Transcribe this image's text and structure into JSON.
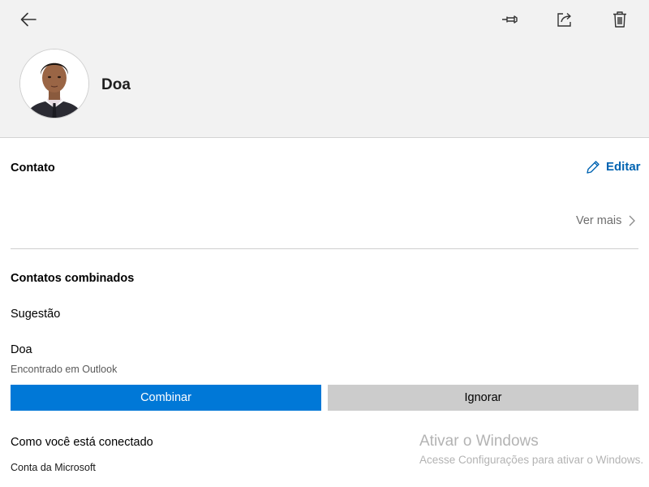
{
  "header": {
    "icons": {
      "back": "arrow-left-icon",
      "pin": "pin-icon",
      "share": "share-icon",
      "delete": "trash-icon"
    },
    "profile_name": "Doa"
  },
  "contact_section": {
    "title": "Contato",
    "edit_label": "Editar",
    "see_more_label": "Ver mais"
  },
  "merged_section": {
    "title": "Contatos combinados",
    "suggestion_label": "Sugestão",
    "suggested_contact_name": "Doa",
    "suggested_contact_source": "Encontrado em Outlook",
    "combine_label": "Combinar",
    "ignore_label": "Ignorar"
  },
  "connection_section": {
    "title": "Como você está conectado",
    "account": "Conta da Microsoft"
  },
  "watermark": {
    "title": "Ativar o Windows",
    "subtitle": "Acesse Configurações para ativar o Windows."
  },
  "colors": {
    "accent": "#0078d7",
    "link": "#0063b1",
    "header_bg": "#f2f2f2",
    "secondary_button": "#cccccc"
  }
}
